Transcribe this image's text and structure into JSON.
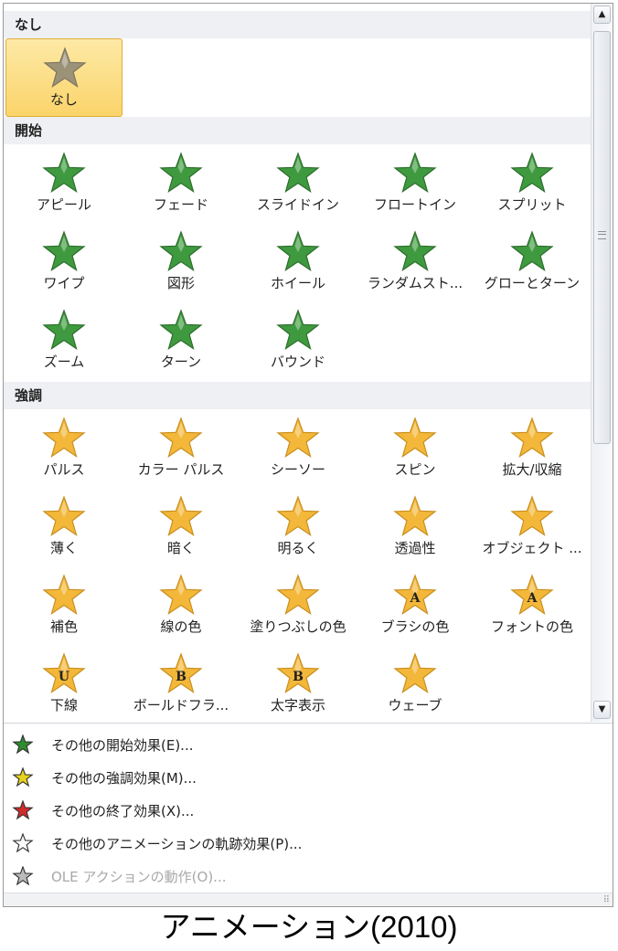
{
  "colors": {
    "entrance": "#3f9a3f",
    "emphasis": "#f3b73a",
    "header_bg": "#eef0f3",
    "selected": "#fbd46a"
  },
  "sections": [
    {
      "title": "なし",
      "items": [
        {
          "label": "なし",
          "icon": "none-star-icon",
          "selected": true
        }
      ]
    },
    {
      "title": "開始",
      "items": [
        {
          "label": "アピール",
          "icon": "appear-star-icon"
        },
        {
          "label": "フェード",
          "icon": "fade-star-icon"
        },
        {
          "label": "スライドイン",
          "icon": "fly-in-star-icon"
        },
        {
          "label": "フロートイン",
          "icon": "float-in-star-icon"
        },
        {
          "label": "スプリット",
          "icon": "split-star-icon"
        },
        {
          "label": "ワイプ",
          "icon": "wipe-star-icon"
        },
        {
          "label": "図形",
          "icon": "shape-star-icon"
        },
        {
          "label": "ホイール",
          "icon": "wheel-star-icon"
        },
        {
          "label": "ランダムスト...",
          "icon": "random-bars-star-icon"
        },
        {
          "label": "グローとターン",
          "icon": "grow-turn-star-icon"
        },
        {
          "label": "ズーム",
          "icon": "zoom-star-icon"
        },
        {
          "label": "ターン",
          "icon": "swivel-star-icon"
        },
        {
          "label": "バウンド",
          "icon": "bounce-star-icon"
        }
      ]
    },
    {
      "title": "強調",
      "items": [
        {
          "label": "パルス",
          "icon": "pulse-star-icon"
        },
        {
          "label": "カラー パルス",
          "icon": "color-pulse-star-icon"
        },
        {
          "label": "シーソー",
          "icon": "teeter-star-icon"
        },
        {
          "label": "スピン",
          "icon": "spin-star-icon"
        },
        {
          "label": "拡大/収縮",
          "icon": "grow-shrink-star-icon"
        },
        {
          "label": "薄く",
          "icon": "desaturate-star-icon"
        },
        {
          "label": "暗く",
          "icon": "darken-star-icon"
        },
        {
          "label": "明るく",
          "icon": "lighten-star-icon"
        },
        {
          "label": "透過性",
          "icon": "transparency-star-icon"
        },
        {
          "label": "オブジェクト ...",
          "icon": "object-color-star-icon"
        },
        {
          "label": "補色",
          "icon": "complementary-color-star-icon"
        },
        {
          "label": "線の色",
          "icon": "line-color-star-icon"
        },
        {
          "label": "塗りつぶしの色",
          "icon": "fill-color-star-icon"
        },
        {
          "label": "ブラシの色",
          "icon": "brush-color-star-icon",
          "letter": "A"
        },
        {
          "label": "フォントの色",
          "icon": "font-color-star-icon",
          "letter": "A"
        },
        {
          "label": "下線",
          "icon": "underline-star-icon",
          "letter": "U"
        },
        {
          "label": "ボールドフラ...",
          "icon": "bold-flash-star-icon",
          "letter": "B"
        },
        {
          "label": "太字表示",
          "icon": "bold-reveal-star-icon",
          "letter": "B"
        },
        {
          "label": "ウェーブ",
          "icon": "wave-star-icon"
        }
      ]
    }
  ],
  "menu": [
    {
      "label": "その他の開始効果(E)...",
      "icon": "more-entrance-icon",
      "color": "#2e8b2e",
      "enabled": true
    },
    {
      "label": "その他の強調効果(M)...",
      "icon": "more-emphasis-icon",
      "color": "#e6d21e",
      "enabled": true
    },
    {
      "label": "その他の終了効果(X)...",
      "icon": "more-exit-icon",
      "color": "#d42a2a",
      "enabled": true
    },
    {
      "label": "その他のアニメーションの軌跡効果(P)...",
      "icon": "more-motion-path-icon",
      "color": "#ffffff",
      "enabled": true
    },
    {
      "label": "OLE アクションの動作(O)...",
      "icon": "ole-action-icon",
      "color": "#bbbbbb",
      "enabled": false
    }
  ],
  "caption": "アニメーション(2010)"
}
